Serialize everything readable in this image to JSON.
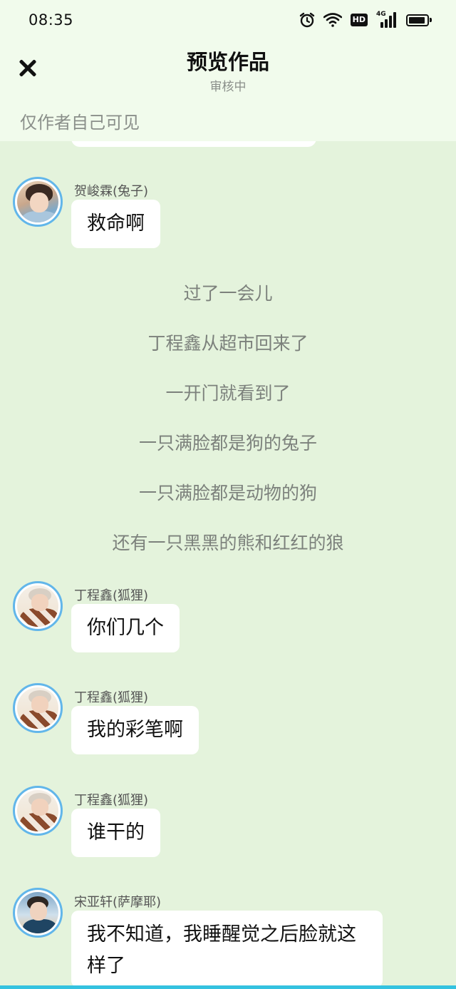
{
  "status_bar": {
    "time": "08:35",
    "icons": [
      "alarm-icon",
      "wifi-icon",
      "hd-icon",
      "signal-4g-icon",
      "battery-icon"
    ],
    "hd_label": "HD",
    "network_label": "4G"
  },
  "header": {
    "title": "预览作品",
    "subtitle": "审核中",
    "visibility_note": "仅作者自己可见",
    "close_icon": "close-icon"
  },
  "messages": [
    {
      "sender": "贺峻霖(兔子)",
      "text": "救命啊",
      "avatar": "avatar-rabbit"
    }
  ],
  "narration": [
    "过了一会儿",
    "丁程鑫从超市回来了",
    "一开门就看到了",
    "一只满脸都是狗的兔子",
    "一只满脸都是动物的狗",
    "还有一只黑黑的熊和红红的狼"
  ],
  "messages_after": [
    {
      "sender": "丁程鑫(狐狸)",
      "text": "你们几个",
      "avatar": "avatar-fox"
    },
    {
      "sender": "丁程鑫(狐狸)",
      "text": "我的彩笔啊",
      "avatar": "avatar-fox"
    },
    {
      "sender": "丁程鑫(狐狸)",
      "text": "谁干的",
      "avatar": "avatar-fox"
    },
    {
      "sender": "宋亚轩(萨摩耶)",
      "text": "我不知道，我睡醒觉之后脸就这样了",
      "avatar": "avatar-goat"
    }
  ],
  "colors": {
    "background": "#e4f3dc",
    "header_bg": "#f1fbec",
    "bubble": "#ffffff",
    "avatar_ring": "#62b6ea",
    "bottom_strip": "#34c2e0"
  }
}
